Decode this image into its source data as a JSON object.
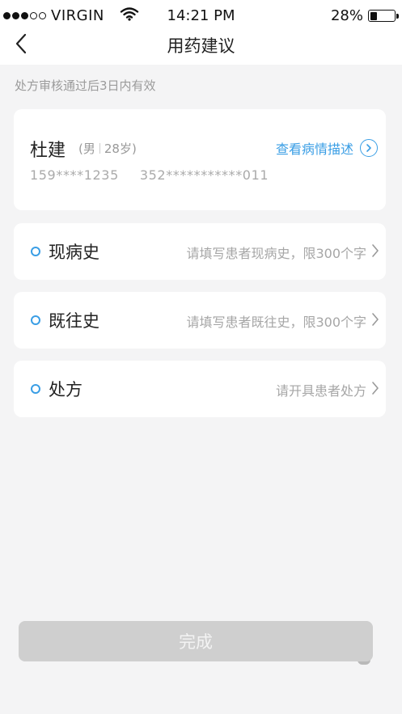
{
  "status_bar": {
    "signal_dots": [
      true,
      true,
      true,
      false,
      false
    ],
    "carrier": "VIRGIN",
    "wifi_icon": "wifi-icon",
    "time": "14:21 PM",
    "battery_percent": "28%",
    "battery_level": 0.28
  },
  "nav": {
    "back_icon": "chevron-left-icon",
    "title": "用药建议"
  },
  "notice": "处方审核通过后3日内有效",
  "patient": {
    "name": "杜建",
    "gender": "男",
    "age": "28岁",
    "phone": "159****1235",
    "id_number": "352***********011",
    "view_desc_label": "查看病情描述",
    "view_desc_icon": "circle-arrow-right-icon"
  },
  "rows": [
    {
      "label": "现病史",
      "placeholder": "请填写患者现病史，限300个字"
    },
    {
      "label": "既往史",
      "placeholder": "请填写患者既往史，限300个字"
    },
    {
      "label": "处方",
      "placeholder": "请开具患者处方"
    }
  ],
  "done_label": "完成",
  "colors": {
    "accent": "#3a9ee5",
    "background": "#f4f4f5",
    "disabled_button": "#cfcfcf"
  }
}
